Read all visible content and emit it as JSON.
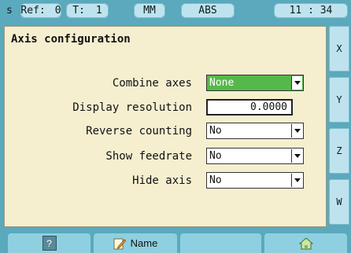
{
  "status_bar": {
    "mode": "s",
    "ref_label": "Ref:",
    "ref_value": "0",
    "tool_label": "T:",
    "tool_value": "1",
    "units": "MM",
    "position_mode": "ABS",
    "time": "11 : 34"
  },
  "panel": {
    "title": "Axis configuration",
    "fields": [
      {
        "label": "Combine axes",
        "type": "dropdown",
        "value": "None",
        "active": true
      },
      {
        "label": "Display resolution",
        "type": "text",
        "value": "0.0000"
      },
      {
        "label": "Reverse counting",
        "type": "dropdown",
        "value": "No"
      },
      {
        "label": "Show feedrate",
        "type": "dropdown",
        "value": "No"
      },
      {
        "label": "Hide axis",
        "type": "dropdown",
        "value": "No"
      }
    ]
  },
  "side_tabs": [
    "X",
    "Y",
    "Z",
    "W"
  ],
  "softkeys": {
    "help_label": "?",
    "name_label": "Name"
  },
  "colors": {
    "background": "#5aa9bd",
    "panel": "#f5efd0",
    "active_field": "#55b84a",
    "softkey": "#8fd0e0"
  }
}
